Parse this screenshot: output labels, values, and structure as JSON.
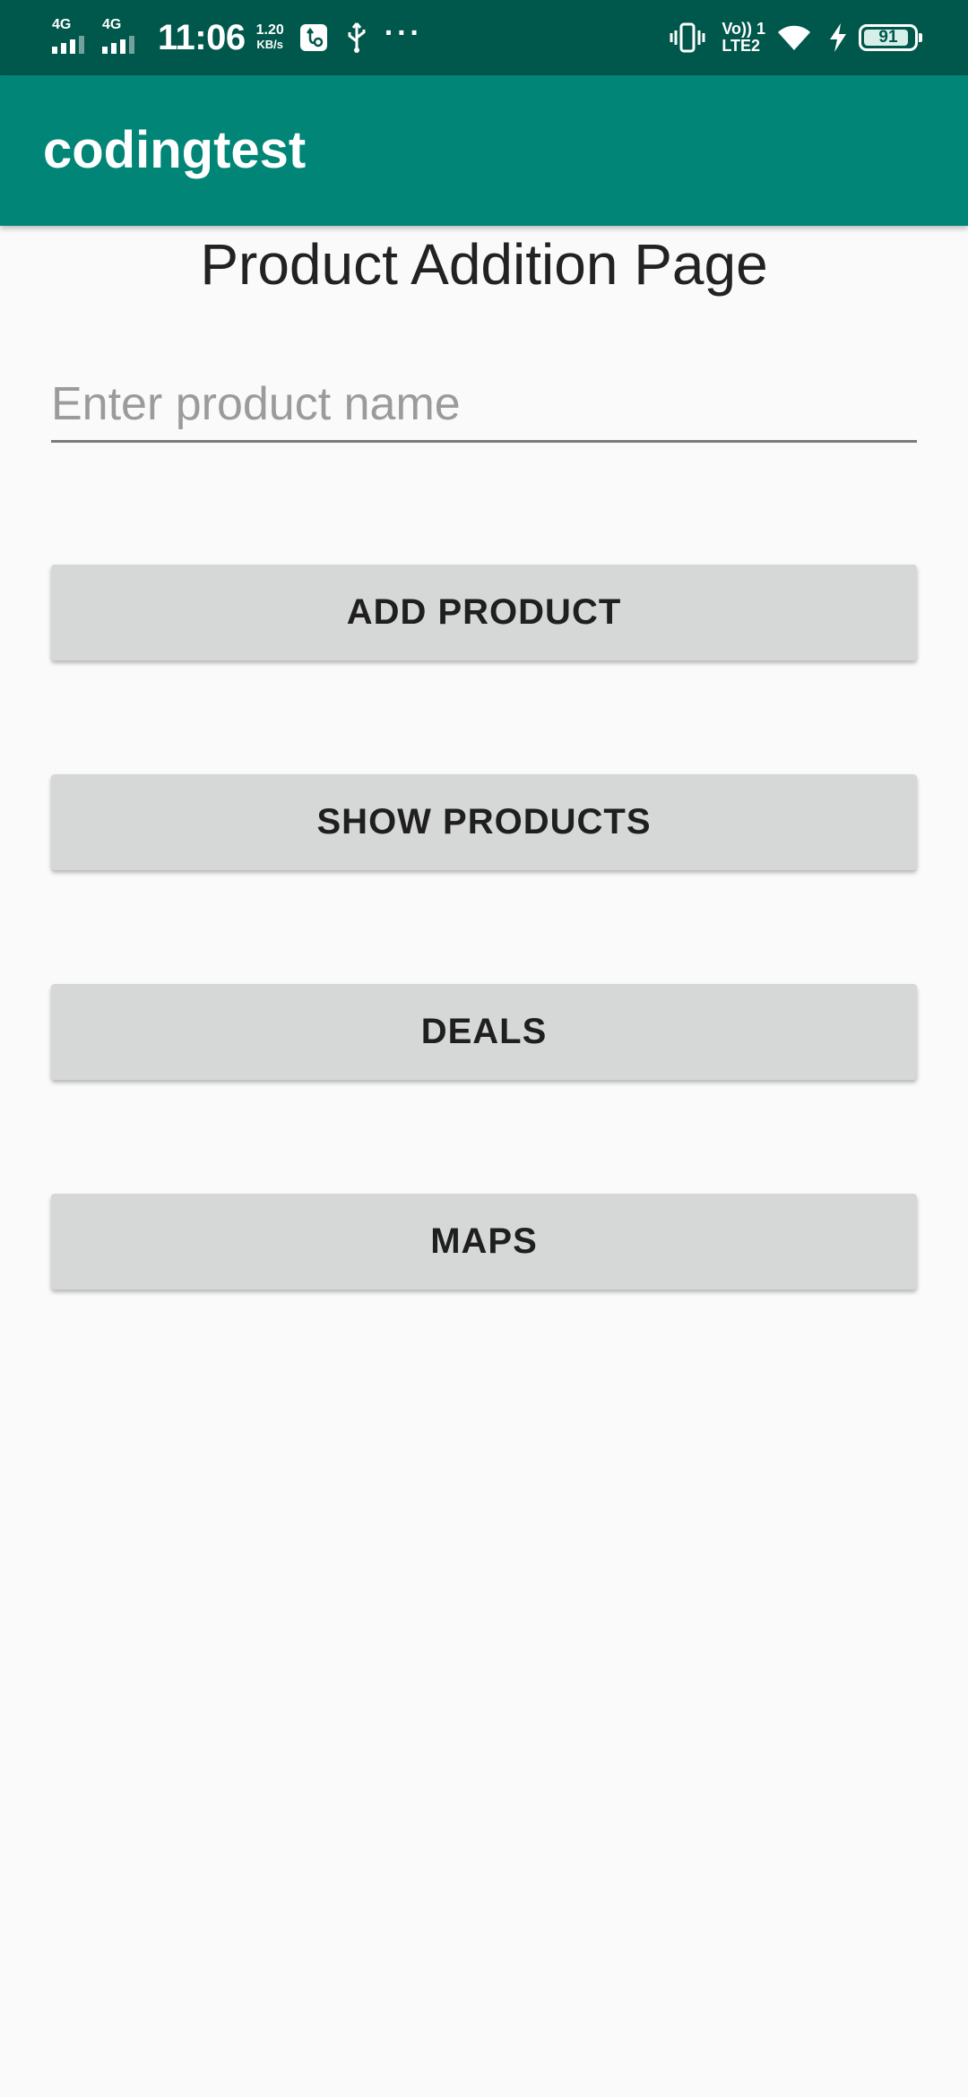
{
  "status_bar": {
    "network_1": "4G",
    "network_2": "4G",
    "time": "11:06",
    "speed_value": "1.20",
    "speed_unit": "KB/s",
    "more": "···",
    "volte_top": "Vo)) 1",
    "volte_bottom": "LTE2",
    "battery": "91",
    "battery_level": 0.91,
    "icons": [
      "signal-icon",
      "signal-icon",
      "usb-debug-icon",
      "usb-icon",
      "vibrate-icon",
      "wifi-icon",
      "charging-icon",
      "battery-icon"
    ]
  },
  "app_bar": {
    "title": "codingtest",
    "color": "#008577"
  },
  "page": {
    "title": "Product Addition Page"
  },
  "product_input": {
    "placeholder": "Enter product name",
    "value": ""
  },
  "buttons": {
    "add_product": "ADD PRODUCT",
    "show_products": "SHOW PRODUCTS",
    "deals": "DEALS",
    "maps": "MAPS"
  },
  "colors": {
    "status_bar": "#00574b",
    "app_bar": "#008577",
    "button": "#d6d7d7",
    "background": "#fafafa"
  }
}
